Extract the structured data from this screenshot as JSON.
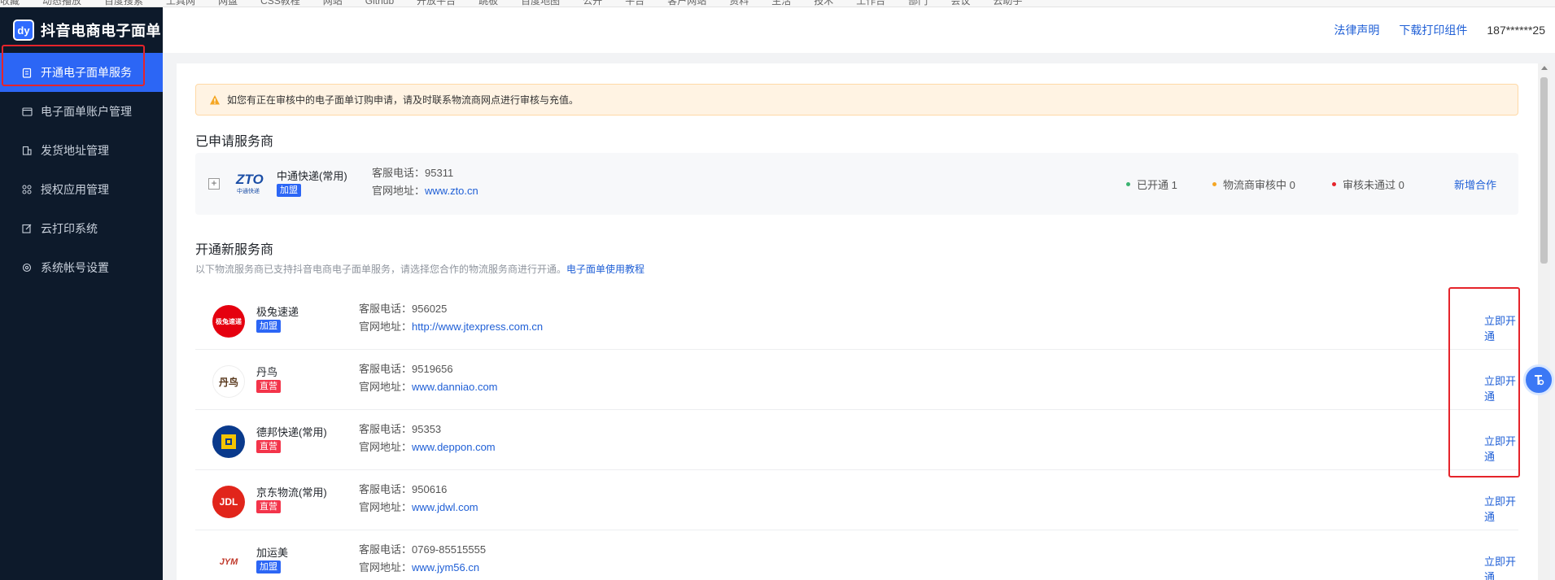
{
  "bookmarks": [
    "收藏",
    "动态播放",
    "百度搜索",
    "工具网",
    "网盘",
    "CSS教程",
    "网站",
    "Github",
    "开放平台",
    "跳板",
    "百度地图",
    "公开",
    "平台",
    "客户网站",
    "资料",
    "生活",
    "技术",
    "工作台",
    "部门",
    "会议",
    "云助手"
  ],
  "app": {
    "title": "抖音电商电子面单",
    "logo_text": "dy"
  },
  "sidebar": {
    "items": [
      {
        "label": "开通电子面单服务",
        "icon": "document-icon",
        "active": true
      },
      {
        "label": "电子面单账户管理",
        "icon": "wallet-icon",
        "active": false
      },
      {
        "label": "发货地址管理",
        "icon": "building-icon",
        "active": false
      },
      {
        "label": "授权应用管理",
        "icon": "apps-icon",
        "active": false
      },
      {
        "label": "云打印系统",
        "icon": "edit-icon",
        "active": false
      },
      {
        "label": "系统帐号设置",
        "icon": "settings-icon",
        "active": false
      }
    ]
  },
  "header": {
    "legal_link": "法律声明",
    "download_link": "下载打印组件",
    "user": "187******25"
  },
  "notice": "如您有正在审核中的电子面单订购申请，请及时联系物流商网点进行审核与充值。",
  "applied": {
    "title": "已申请服务商",
    "carrier": {
      "name": "中通快递(常用)",
      "tag": "加盟",
      "phone_label": "客服电话：",
      "phone": "95311",
      "site_label": "官网地址：",
      "site": "www.zto.cn",
      "logo_text": "ZTO",
      "logo_sub": "中通快递"
    },
    "stats": [
      {
        "label": "已开通 1",
        "color": "#3cb371"
      },
      {
        "label": "物流商审核中 0",
        "color": "#f5a623"
      },
      {
        "label": "审核未通过 0",
        "color": "#e5242b"
      }
    ],
    "action": "新增合作"
  },
  "new_section": {
    "title": "开通新服务商",
    "subtitle": "以下物流服务商已支持抖音电商电子面单服务，请选择您合作的物流服务商进行开通。",
    "tutorial_link": "电子面单使用教程",
    "providers": [
      {
        "name": "极兔速递",
        "tag": "加盟",
        "tag_color": "blue",
        "phone_label": "客服电话：",
        "phone": "956025",
        "site_label": "官网地址：",
        "site": "http://www.jtexpress.com.cn",
        "action": "立即开通",
        "logo_text": "极兔速递",
        "logo_color": "#e5000f"
      },
      {
        "name": "丹鸟",
        "tag": "直营",
        "tag_color": "red",
        "phone_label": "客服电话：",
        "phone": "9519656",
        "site_label": "官网地址：",
        "site": "www.danniao.com",
        "action": "立即开通",
        "logo_text": "丹鸟",
        "logo_color": "#ffffff"
      },
      {
        "name": "德邦快递(常用)",
        "tag": "直营",
        "tag_color": "red",
        "phone_label": "客服电话：",
        "phone": "95353",
        "site_label": "官网地址：",
        "site": "www.deppon.com",
        "action": "立即开通",
        "logo_text": "",
        "logo_color": "#0a3a8c"
      },
      {
        "name": "京东物流(常用)",
        "tag": "直营",
        "tag_color": "red",
        "phone_label": "客服电话：",
        "phone": "950616",
        "site_label": "官网地址：",
        "site": "www.jdwl.com",
        "action": "立即开通",
        "logo_text": "JDL",
        "logo_color": "#e1251b"
      },
      {
        "name": "加运美",
        "tag": "加盟",
        "tag_color": "blue",
        "phone_label": "客服电话：",
        "phone": "0769-85515555",
        "site_label": "官网地址：",
        "site": "www.jym56.cn",
        "action": "立即开通",
        "logo_text": "JYM",
        "logo_color": "#ffffff"
      }
    ]
  }
}
